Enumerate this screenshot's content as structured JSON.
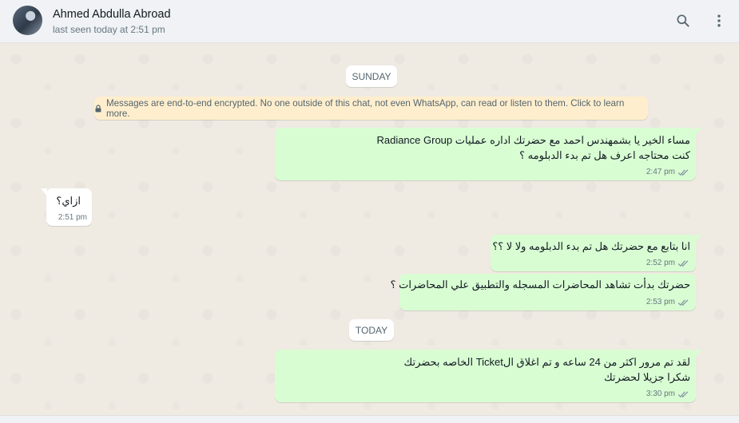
{
  "header": {
    "contact_name": "Ahmed Abdulla Abroad",
    "last_seen": "last seen today at 2:51 pm",
    "icons": [
      "search-icon",
      "menu-icon"
    ]
  },
  "encryption_notice": "Messages are end-to-end encrypted. No one outside of this chat, not even WhatsApp, can read or listen to them. Click to learn more.",
  "dates": {
    "sunday": "SUNDAY",
    "today": "TODAY"
  },
  "messages": [
    {
      "direction": "out",
      "lines": [
        "مساء الخير يا بشمهندس احمد مع حضرتك اداره عمليات Radiance Group",
        "كنت محتاجه اعرف هل تم بدء الدبلومه ؟"
      ],
      "time": "2:47 pm",
      "status": "read"
    },
    {
      "direction": "in",
      "lines": [
        "ازاي؟"
      ],
      "time": "2:51 pm"
    },
    {
      "direction": "out",
      "lines": [
        "انا بتابع مع حضرتك هل تم بدء الدبلومه ولا لا ؟؟"
      ],
      "time": "2:52 pm",
      "status": "read"
    },
    {
      "direction": "out",
      "lines": [
        "حضرتك بدأت تشاهد المحاضرات المسجله والتطبيق علي المحاضرات ؟"
      ],
      "time": "2:53 pm",
      "status": "read"
    },
    {
      "direction": "out",
      "lines": [
        "لقد تم مرور اكثر من  24 ساعه و تم اغلاق الTicket الخاصه بحضرتك",
        "شكرا جزيلا لحضرتك"
      ],
      "time": "3:30 pm",
      "status": "read"
    }
  ],
  "colors": {
    "outgoing_bubble": "#d9fdd3",
    "incoming_bubble": "#ffffff",
    "encryption_bg": "#ffeecd",
    "read_ticks": "#8696a0"
  }
}
